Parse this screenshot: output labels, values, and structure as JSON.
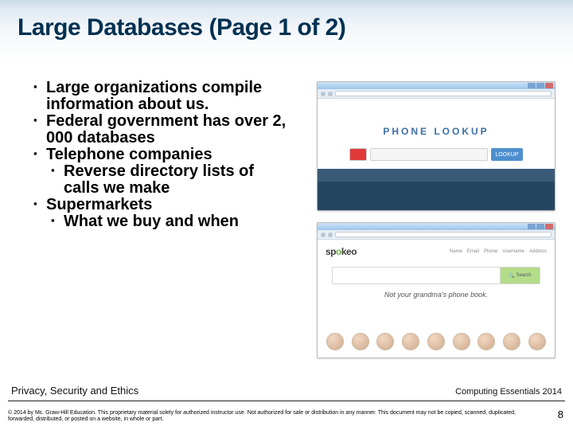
{
  "title": "Large Databases (Page 1 of 2)",
  "bullets": {
    "b1": "Large organizations compile information about us.",
    "b2": "Federal government has over 2, 000 databases",
    "b3": "Telephone companies",
    "b3a": "Reverse directory lists of calls we make",
    "b4": "Supermarkets",
    "b4a": "What we buy and when"
  },
  "shot1": {
    "hero": "PHONE LOOKUP",
    "button": "LOOKUP"
  },
  "shot2": {
    "logo_pre": "sp",
    "logo_eye": "o",
    "logo_post": "keo",
    "tabs": [
      "Name",
      "Email",
      "Phone",
      "Username",
      "Address"
    ],
    "search_button": "Search",
    "tagline": "Not your grandma's phone book."
  },
  "footer": {
    "chapter": "Privacy, Security and Ethics",
    "edition": "Computing Essentials 2014",
    "copy": "© 2014 by Mc. Graw-Hill Education. This proprietary material solely for authorized instructor use. Not authorized for sale or distribution in any manner. This document may not be copied, scanned, duplicated, forwarded, distributed, or posted on a website, in whole or part.",
    "page": "8"
  }
}
